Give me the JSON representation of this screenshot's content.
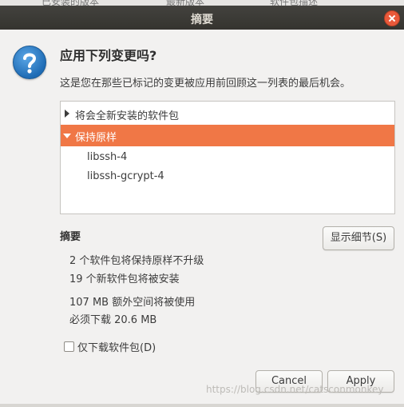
{
  "background_window": {
    "columns": [
      "已安装的版本",
      "最新版本",
      "软件包描述"
    ]
  },
  "window": {
    "title": "摘要"
  },
  "dialog": {
    "heading": "应用下列变更吗?",
    "description": "这是您在那些已标记的变更被应用前回顾这一列表的最后机会。"
  },
  "tree": {
    "items": [
      {
        "label": "将会全新安装的软件包",
        "expanded": false,
        "selected": false
      },
      {
        "label": "保持原样",
        "expanded": true,
        "selected": true,
        "children": [
          "libssh-4",
          "libssh-gcrypt-4"
        ]
      }
    ]
  },
  "summary": {
    "title": "摘要",
    "details_button": "显示细节(S)",
    "lines": [
      "2 个软件包将保持原样不升级",
      "19 个新软件包将被安装",
      "107 MB 额外空间将被使用",
      "必须下载 20.6 MB"
    ]
  },
  "download_only": {
    "label": "仅下载软件包(D)",
    "checked": false
  },
  "buttons": {
    "cancel": "Cancel",
    "apply": "Apply"
  },
  "watermark": "https://blog.csdn.net/catsconmonkey",
  "colors": {
    "titlebar": "#3c3b37",
    "selection": "#f07746",
    "close": "#e9593a",
    "background": "#f2f1f0"
  }
}
